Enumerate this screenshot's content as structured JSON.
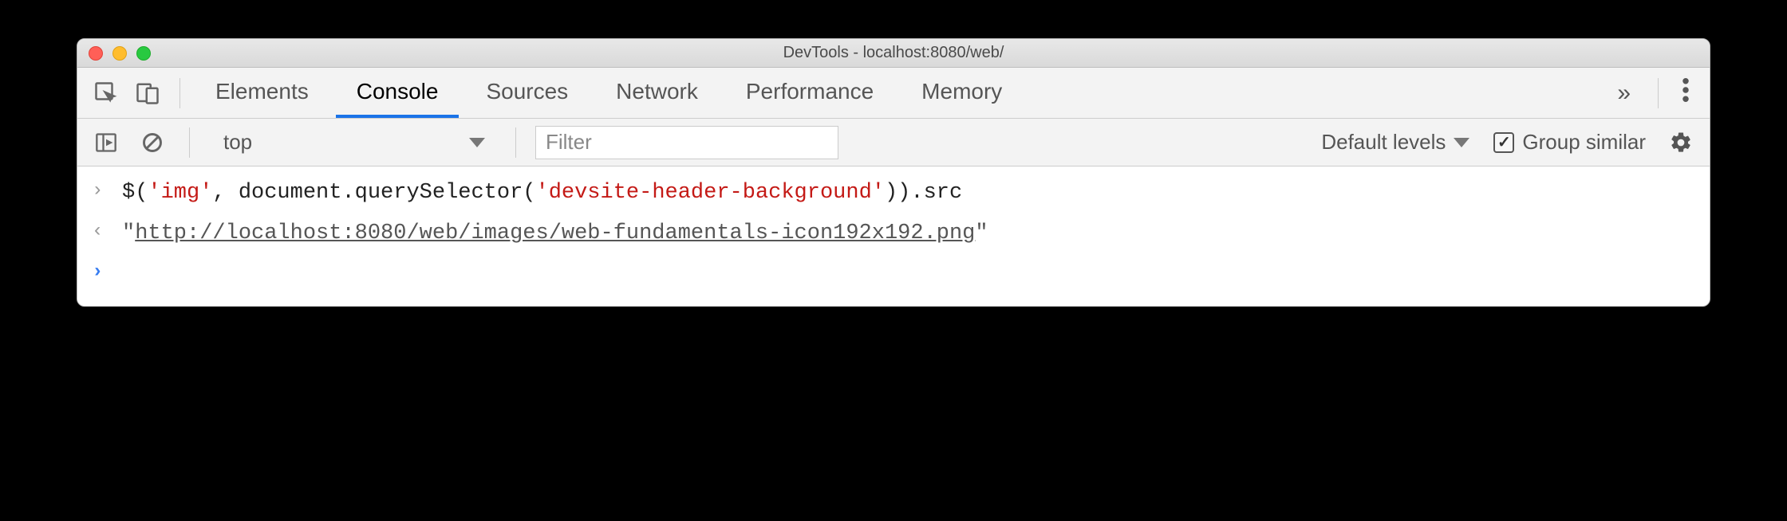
{
  "window": {
    "title": "DevTools - localhost:8080/web/"
  },
  "tabs": {
    "items": [
      "Elements",
      "Console",
      "Sources",
      "Network",
      "Performance",
      "Memory"
    ],
    "active": "Console"
  },
  "filterbar": {
    "context": "top",
    "filter_placeholder": "Filter",
    "levels_label": "Default levels",
    "group_similar_label": "Group similar",
    "group_similar_checked": true
  },
  "console": {
    "input_parts": {
      "p1": "$(",
      "s1": "'img'",
      "p2": ", document.querySelector(",
      "s2": "'devsite-header-background'",
      "p3": ")).src"
    },
    "output": {
      "quote_open": "\"",
      "url": "http://localhost:8080/web/images/web-fundamentals-icon192x192.png",
      "quote_close": "\""
    }
  }
}
